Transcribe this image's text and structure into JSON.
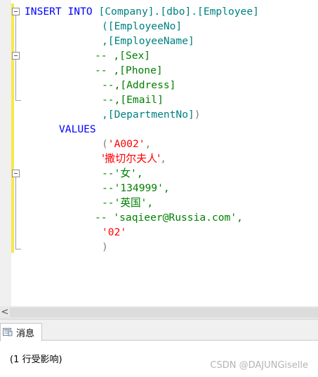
{
  "editor": {
    "line1": {
      "kw1": "INSERT",
      "kw2": "INTO",
      "target": "[Company].[dbo].[Employee]"
    },
    "line2": {
      "text": "([EmployeeNo]"
    },
    "line3": {
      "text": ",[EmployeeName]"
    },
    "line4": {
      "text": "-- ,[Sex]"
    },
    "line5": {
      "text": "-- ,[Phone]"
    },
    "line6": {
      "text": "--,[Address]"
    },
    "line7": {
      "text": "--,[Email]"
    },
    "line8": {
      "col": ",[DepartmentNo]",
      "close": ")"
    },
    "line9": {
      "text": "VALUES"
    },
    "line10": {
      "open": "(",
      "value": "'A002'",
      "comma": ","
    },
    "line11": {
      "value": "'撒切尔夫人'",
      "comma": ","
    },
    "line12": {
      "text": "--'女',"
    },
    "line13": {
      "text": "--'134999',"
    },
    "line14": {
      "text": "--'英国',"
    },
    "line15": {
      "text": "-- 'saqieer@Russia.com',"
    },
    "line16": {
      "value": "'02'"
    },
    "line17": {
      "text": ")"
    }
  },
  "scrollbar": {
    "left_arrow": "<"
  },
  "results": {
    "tab_label": "消息",
    "message": "(1 行受影响)"
  },
  "watermark": "CSDN @DAJUNGiselle",
  "colors": {
    "keyword": "#0000ff",
    "identifier": "#008080",
    "comment": "#008000",
    "string": "#ff0000",
    "changebar": "#f5e94a"
  }
}
